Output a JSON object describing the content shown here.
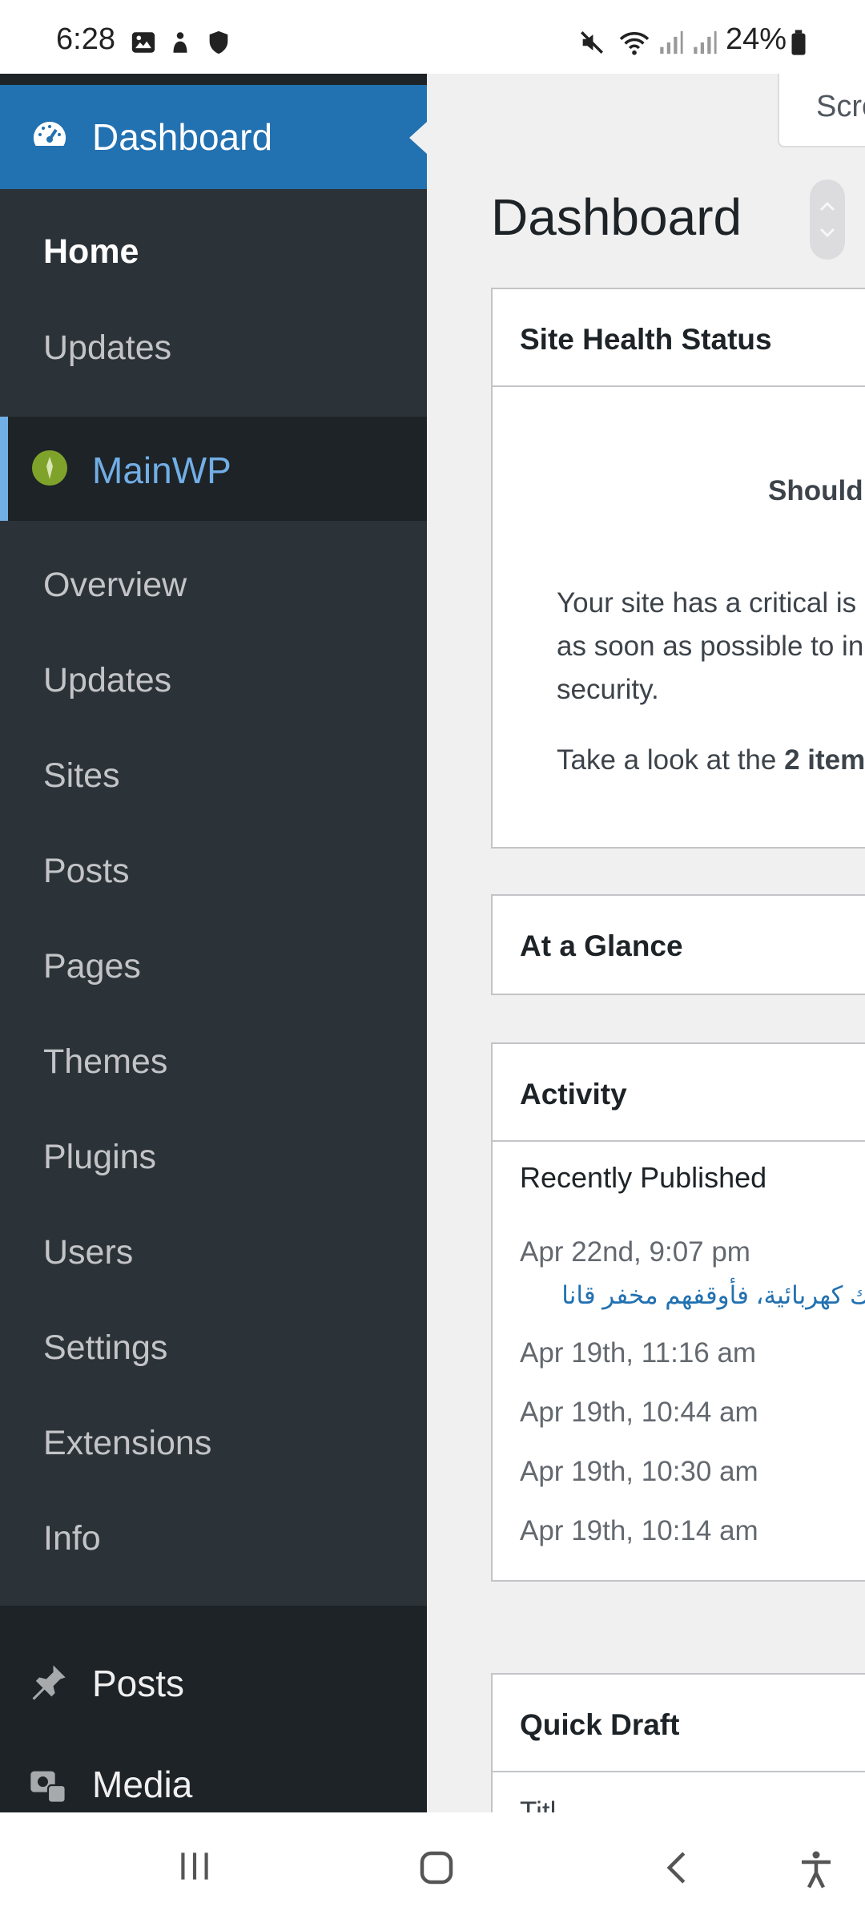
{
  "status_bar": {
    "time": "6:28",
    "battery": "24%",
    "icons": [
      "image-icon",
      "person-icon",
      "shield-icon",
      "mute-icon",
      "wifi-icon",
      "signal-icon",
      "signal-icon",
      "battery-icon"
    ]
  },
  "sidebar": {
    "dashboard_label": "Dashboard",
    "dashboard_sub": [
      "Home",
      "Updates"
    ],
    "mainwp_label": "MainWP",
    "mainwp_sub": [
      "Overview",
      "Updates",
      "Sites",
      "Posts",
      "Pages",
      "Themes",
      "Plugins",
      "Users",
      "Settings",
      "Extensions",
      "Info"
    ],
    "posts_label": "Posts",
    "media_label": "Media",
    "colors": {
      "bg": "#2c3338",
      "current": "#2271b1",
      "mainwp_text": "#72aee6"
    }
  },
  "main": {
    "screen_options": "Scre",
    "title": "Dashboard",
    "site_health": {
      "title": "Site Health Status",
      "status": "Should",
      "body_lines": [
        "Your site has a critical is",
        "as soon as possible to in",
        "security."
      ],
      "take_look_prefix": "Take a look at the ",
      "take_look_bold": "2 item"
    },
    "at_a_glance": {
      "title": "At a Glance"
    },
    "activity": {
      "title": "Activity",
      "recently_published": "Recently Published",
      "entries": [
        "Apr 22nd, 9:07 pm",
        "Apr 19th, 11:16 am",
        "Apr 19th, 10:44 am",
        "Apr 19th, 10:30 am",
        "Apr 19th, 10:14 am"
      ],
      "arabic_link": "سلاك كهربائية، فأوقفهم مخفر قانا"
    },
    "quick_draft": {
      "title": "Quick Draft",
      "partial_label": "Titl"
    }
  }
}
